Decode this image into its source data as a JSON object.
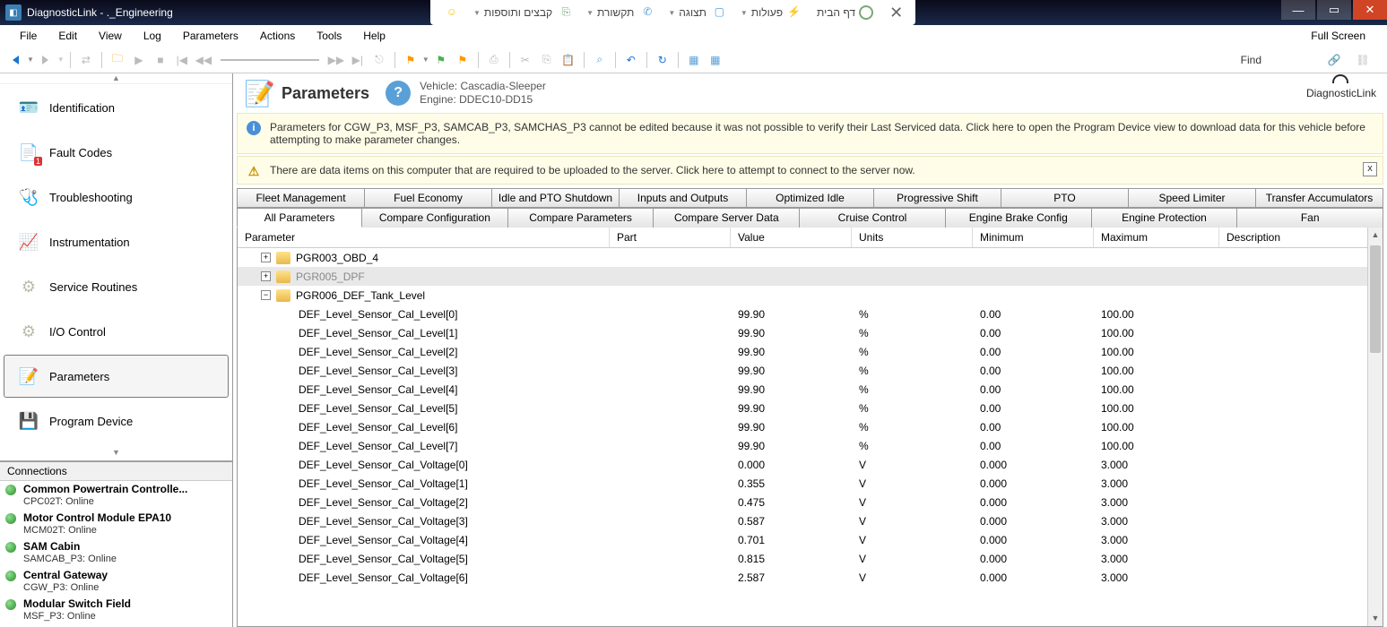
{
  "window": {
    "title": "DiagnosticLink - ._Engineering"
  },
  "ext_toolbar": {
    "close": "✕",
    "items": [
      "דף הבית",
      "פעולות",
      "תצוגה",
      "תקשורת",
      "קבצים ותוספות"
    ]
  },
  "menubar": [
    "File",
    "Edit",
    "View",
    "Log",
    "Parameters",
    "Actions",
    "Tools",
    "Help"
  ],
  "full_screen": "Full Screen",
  "find_label": "Find",
  "sidebar": {
    "items": [
      {
        "label": "Identification"
      },
      {
        "label": "Fault Codes"
      },
      {
        "label": "Troubleshooting"
      },
      {
        "label": "Instrumentation"
      },
      {
        "label": "Service Routines"
      },
      {
        "label": "I/O Control"
      },
      {
        "label": "Parameters"
      },
      {
        "label": "Program Device"
      }
    ],
    "connections_header": "Connections",
    "connections": [
      {
        "name": "Common Powertrain Controlle...",
        "sub": "CPC02T: Online"
      },
      {
        "name": "Motor Control Module EPA10",
        "sub": "MCM02T: Online"
      },
      {
        "name": "SAM Cabin",
        "sub": "SAMCAB_P3: Online"
      },
      {
        "name": "Central Gateway",
        "sub": "CGW_P3: Online"
      },
      {
        "name": "Modular Switch Field",
        "sub": "MSF_P3: Online"
      }
    ]
  },
  "header": {
    "title": "Parameters",
    "vehicle_label": "Vehicle: Cascadia-Sleeper",
    "engine_label": "Engine: DDEC10-DD15",
    "logo": "DiagnosticLink"
  },
  "notices": {
    "info": "Parameters for CGW_P3, MSF_P3, SAMCAB_P3, SAMCHAS_P3 cannot be edited because it was not possible to verify their Last Serviced data. Click here to open the Program Device view to download data for this vehicle before attempting to make parameter changes.",
    "warn": "There are data items on this computer that are required to be uploaded to the server. Click here to attempt to connect to the server now."
  },
  "tabs_row1": [
    "Fleet Management",
    "Fuel Economy",
    "Idle and PTO Shutdown",
    "Inputs and Outputs",
    "Optimized Idle",
    "Progressive Shift",
    "PTO",
    "Speed Limiter",
    "Transfer Accumulators"
  ],
  "tabs_row2": [
    "All Parameters",
    "Compare Configuration",
    "Compare Parameters",
    "Compare Server Data",
    "Cruise Control",
    "Engine Brake Config",
    "Engine Protection",
    "Fan"
  ],
  "grid": {
    "columns": {
      "parameter": "Parameter",
      "part": "Part",
      "value": "Value",
      "units": "Units",
      "minimum": "Minimum",
      "maximum": "Maximum",
      "description": "Description"
    },
    "groups": [
      {
        "name": "PGR003_OBD_4",
        "expanded": false
      },
      {
        "name": "PGR005_DPF",
        "expanded": false,
        "selected": true
      },
      {
        "name": "PGR006_DEF_Tank_Level",
        "expanded": true
      }
    ],
    "rows": [
      {
        "parameter": "DEF_Level_Sensor_Cal_Level[0]",
        "value": "99.90",
        "units": "%",
        "min": "0.00",
        "max": "100.00"
      },
      {
        "parameter": "DEF_Level_Sensor_Cal_Level[1]",
        "value": "99.90",
        "units": "%",
        "min": "0.00",
        "max": "100.00"
      },
      {
        "parameter": "DEF_Level_Sensor_Cal_Level[2]",
        "value": "99.90",
        "units": "%",
        "min": "0.00",
        "max": "100.00"
      },
      {
        "parameter": "DEF_Level_Sensor_Cal_Level[3]",
        "value": "99.90",
        "units": "%",
        "min": "0.00",
        "max": "100.00"
      },
      {
        "parameter": "DEF_Level_Sensor_Cal_Level[4]",
        "value": "99.90",
        "units": "%",
        "min": "0.00",
        "max": "100.00"
      },
      {
        "parameter": "DEF_Level_Sensor_Cal_Level[5]",
        "value": "99.90",
        "units": "%",
        "min": "0.00",
        "max": "100.00"
      },
      {
        "parameter": "DEF_Level_Sensor_Cal_Level[6]",
        "value": "99.90",
        "units": "%",
        "min": "0.00",
        "max": "100.00"
      },
      {
        "parameter": "DEF_Level_Sensor_Cal_Level[7]",
        "value": "99.90",
        "units": "%",
        "min": "0.00",
        "max": "100.00"
      },
      {
        "parameter": "DEF_Level_Sensor_Cal_Voltage[0]",
        "value": "0.000",
        "units": "V",
        "min": "0.000",
        "max": "3.000"
      },
      {
        "parameter": "DEF_Level_Sensor_Cal_Voltage[1]",
        "value": "0.355",
        "units": "V",
        "min": "0.000",
        "max": "3.000"
      },
      {
        "parameter": "DEF_Level_Sensor_Cal_Voltage[2]",
        "value": "0.475",
        "units": "V",
        "min": "0.000",
        "max": "3.000"
      },
      {
        "parameter": "DEF_Level_Sensor_Cal_Voltage[3]",
        "value": "0.587",
        "units": "V",
        "min": "0.000",
        "max": "3.000"
      },
      {
        "parameter": "DEF_Level_Sensor_Cal_Voltage[4]",
        "value": "0.701",
        "units": "V",
        "min": "0.000",
        "max": "3.000"
      },
      {
        "parameter": "DEF_Level_Sensor_Cal_Voltage[5]",
        "value": "0.815",
        "units": "V",
        "min": "0.000",
        "max": "3.000"
      },
      {
        "parameter": "DEF_Level_Sensor_Cal_Voltage[6]",
        "value": "2.587",
        "units": "V",
        "min": "0.000",
        "max": "3.000"
      }
    ]
  }
}
